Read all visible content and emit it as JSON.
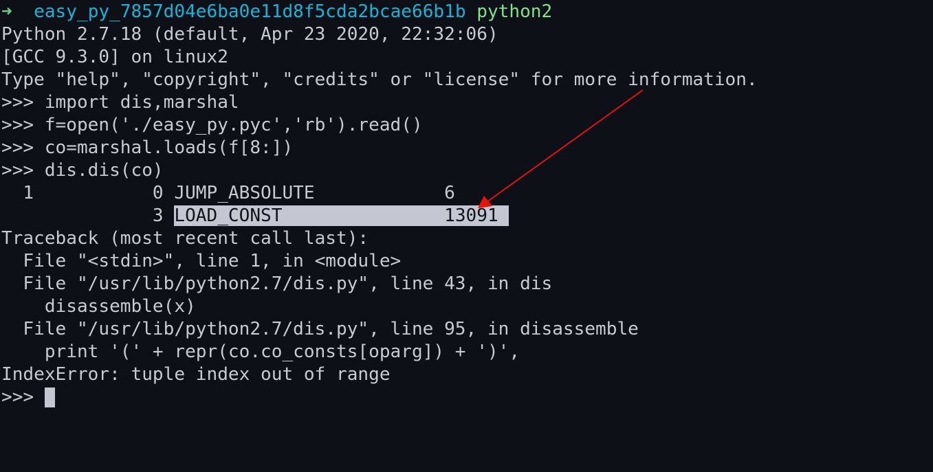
{
  "prompt": {
    "arrow": "➜",
    "directory": "easy_py_7857d04e6ba0e11d8f5cda2bcae66b1b",
    "command": "python2"
  },
  "lines": [
    "Python 2.7.18 (default, Apr 23 2020, 22:32:06)",
    "[GCC 9.3.0] on linux2",
    "Type \"help\", \"copyright\", \"credits\" or \"license\" for more information.",
    ">>> import dis,marshal",
    ">>> f=open('./easy_py.pyc','rb').read()",
    ">>> co=marshal.loads(f[8:])",
    ">>> dis.dis(co)",
    "  1           0 JUMP_ABSOLUTE            6"
  ],
  "highlight_line": {
    "prefix": "              3 ",
    "highlighted": "LOAD_CONST               13091 "
  },
  "traceback": [
    "Traceback (most recent call last):",
    "  File \"<stdin>\", line 1, in <module>",
    "  File \"/usr/lib/python2.7/dis.py\", line 43, in dis",
    "    disassemble(x)",
    "  File \"/usr/lib/python2.7/dis.py\", line 95, in disassemble",
    "    print '(' + repr(co.co_consts[oparg]) + ')',",
    "IndexError: tuple index out of range"
  ],
  "final_prompt": ">>> ",
  "colors": {
    "annotation_arrow": "#e8120c",
    "background": "#0d1017"
  }
}
